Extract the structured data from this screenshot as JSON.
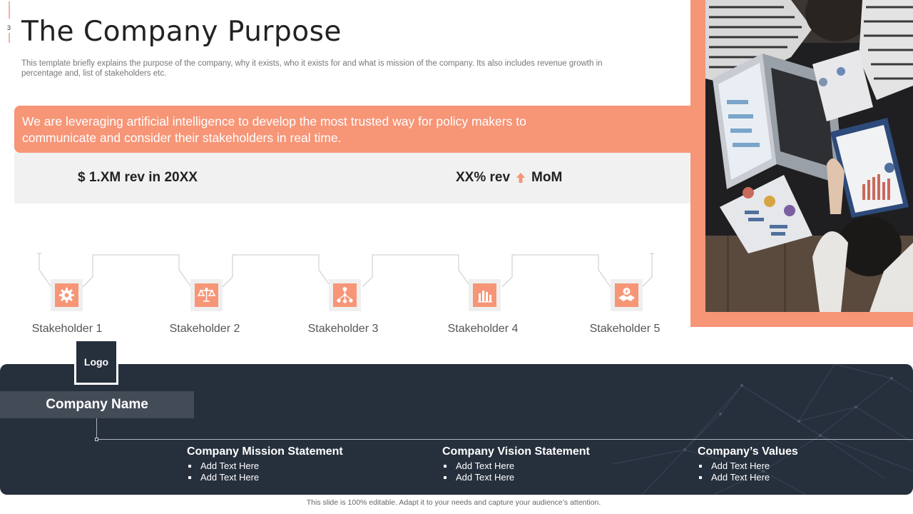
{
  "slide_number": "3",
  "title": "The Company Purpose",
  "subtitle": "This template briefly explains the purpose of the company, why it exists, who it exists for  and what is mission of the company. Its also includes revenue growth in percentage and, list of stakeholders etc.",
  "banner_text": "We are leveraging artificial intelligence to develop the most trusted way for policy makers to communicate and consider their stakeholders in real time.",
  "revenue": {
    "left": "$ 1.XM rev in 20XX",
    "right_prefix": "XX% rev",
    "right_suffix": "MoM"
  },
  "stakeholders": [
    {
      "label": "Stakeholder 1",
      "icon": "gear-icon"
    },
    {
      "label": "Stakeholder 2",
      "icon": "scales-icon"
    },
    {
      "label": "Stakeholder 3",
      "icon": "network-icon"
    },
    {
      "label": "Stakeholder 4",
      "icon": "bar-chart-icon"
    },
    {
      "label": "Stakeholder 5",
      "icon": "handshake-icon"
    }
  ],
  "logo": "Logo",
  "company_name": "Company Name",
  "columns": [
    {
      "title": "Company Mission Statement",
      "items": [
        "Add Text Here",
        "Add Text Here"
      ]
    },
    {
      "title": "Company Vision Statement",
      "items": [
        "Add Text Here",
        "Add Text Here"
      ]
    },
    {
      "title": "Company’s Values",
      "items": [
        "Add Text Here",
        "Add Text Here"
      ]
    }
  ],
  "footnote": "This slide is 100% editable.  Adapt it to your needs and capture your audience’s attention.",
  "colors": {
    "accent": "#f79577",
    "dark": "#262f3c",
    "light_gray": "#f1f1f1"
  }
}
